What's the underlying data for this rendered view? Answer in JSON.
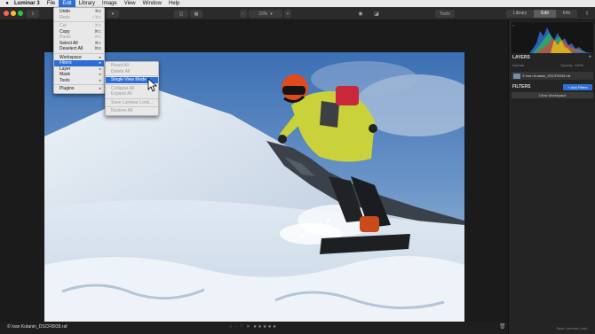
{
  "menubar": {
    "app_name": "Luminar 3",
    "items": [
      "File",
      "Edit",
      "Library",
      "Image",
      "View",
      "Window",
      "Help"
    ],
    "active": "Edit"
  },
  "toolbar": {
    "zoom": "23%",
    "tools_label": "Tools",
    "modes": [
      "Library",
      "Edit",
      "Info"
    ],
    "active_mode": "Edit"
  },
  "edit_menu": {
    "items": [
      {
        "label": "Undo",
        "shortcut": "⌘Z",
        "enabled": true
      },
      {
        "label": "Redo",
        "shortcut": "⇧⌘Z",
        "enabled": false
      },
      {
        "sep": true
      },
      {
        "label": "Cut",
        "shortcut": "⌘X",
        "enabled": false
      },
      {
        "label": "Copy",
        "shortcut": "⌘C",
        "enabled": true
      },
      {
        "label": "Paste",
        "shortcut": "⌘V",
        "enabled": false
      },
      {
        "label": "Select All",
        "shortcut": "⌘A",
        "enabled": true
      },
      {
        "label": "Deselect All",
        "shortcut": "⌘D",
        "enabled": true
      },
      {
        "sep": true
      },
      {
        "label": "Workspace",
        "submenu": true,
        "enabled": true
      },
      {
        "label": "Filters",
        "submenu": true,
        "enabled": true,
        "highlighted": true
      },
      {
        "label": "Layer",
        "submenu": true,
        "enabled": true
      },
      {
        "label": "Mask",
        "submenu": true,
        "enabled": true
      },
      {
        "label": "Tools",
        "submenu": true,
        "enabled": true
      },
      {
        "sep": true
      },
      {
        "label": "Plugins",
        "submenu": true,
        "enabled": true
      }
    ]
  },
  "filters_submenu": {
    "items": [
      {
        "label": "Reset All",
        "enabled": false
      },
      {
        "label": "Delete All",
        "enabled": false
      },
      {
        "sep": true
      },
      {
        "label": "Single View Mode",
        "enabled": true,
        "highlighted": true
      },
      {
        "sep": true
      },
      {
        "label": "Collapse All",
        "enabled": false
      },
      {
        "label": "Expand All",
        "enabled": false
      },
      {
        "sep": true
      },
      {
        "label": "Save Luminar Look...",
        "enabled": false
      },
      {
        "sep": true
      },
      {
        "label": "Restore All",
        "enabled": false
      }
    ]
  },
  "panel": {
    "layers_title": "LAYERS",
    "layer_name": "Normal",
    "layer_opacity": "Opacity: 100%",
    "image_layer": "© Ivan Kutanin_DSCF8939.raf",
    "filters_title": "FILTERS",
    "add_filters": "+ Add Filters",
    "clear_workspace": "Clear Workspace",
    "save_look": "Save Luminar Look..."
  },
  "bottom": {
    "filename": "© Ivan Kutanin_DSCF8939.raf",
    "rating": "○ · ♡   ✕ ★★★★★"
  },
  "colors": {
    "accent": "#2d6fd6",
    "menu_bg": "#e8e8e8",
    "panel_bg": "#242424",
    "jacket": "#c9d23a",
    "helmet": "#e24a1e"
  }
}
